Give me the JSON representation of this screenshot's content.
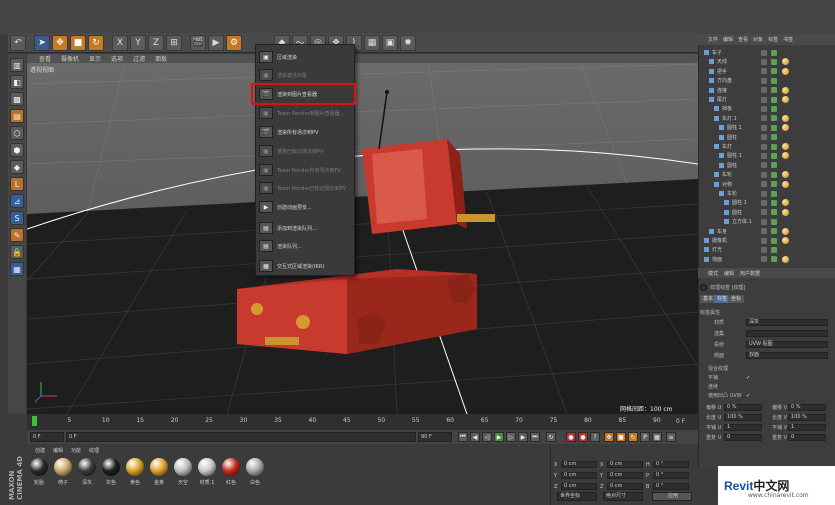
{
  "toolbar": {
    "icons": [
      "undo-icon",
      "select-icon",
      "move-icon",
      "scale-icon",
      "rotate-icon",
      "x-axis",
      "y-axis",
      "z-axis",
      "coord-icon",
      "render-view-icon",
      "render-icon",
      "render-settings-icon"
    ],
    "axis_labels": [
      "X",
      "Y",
      "Z"
    ]
  },
  "viewport": {
    "menu": [
      "查看",
      "摄像机",
      "显示",
      "选项",
      "过滤",
      "面板"
    ],
    "title": "透视视图",
    "grid_info": "网格间距：100 cm"
  },
  "render_menu": {
    "items": [
      {
        "label": "区域渲染",
        "enabled": true
      },
      {
        "label": "渲染激活对象",
        "enabled": false
      },
      {
        "label": "渲染到图片查看器",
        "enabled": true,
        "highlighted": true
      },
      {
        "label": "Team Render到图片查看器...",
        "enabled": false
      },
      {
        "label": "渲染所有场次到PV",
        "enabled": true
      },
      {
        "label": "渲染已标记场次到PV",
        "enabled": false
      },
      {
        "label": "Team Render所有场次到PV",
        "enabled": false
      },
      {
        "label": "Team Render已标记场次到PV",
        "enabled": false
      },
      {
        "label": "创建动画预览...",
        "enabled": true
      },
      {
        "label": "添加到渲染队列...",
        "enabled": true
      },
      {
        "label": "渲染队列...",
        "enabled": true
      },
      {
        "label": "交互式区域渲染(IRR)",
        "enabled": true
      }
    ]
  },
  "object_manager": {
    "menu": [
      "文件",
      "编辑",
      "查看",
      "对象",
      "标签",
      "书签"
    ],
    "rows": [
      {
        "label": "车子",
        "indent": 0
      },
      {
        "label": "天线",
        "indent": 1
      },
      {
        "label": "把手",
        "indent": 1
      },
      {
        "label": "方向盘",
        "indent": 1
      },
      {
        "label": "连接",
        "indent": 1
      },
      {
        "label": "尾灯",
        "indent": 1
      },
      {
        "label": "挡板",
        "indent": 2
      },
      {
        "label": "车灯.1",
        "indent": 2
      },
      {
        "label": "圆柱.1",
        "indent": 3
      },
      {
        "label": "圆柱",
        "indent": 3
      },
      {
        "label": "车灯",
        "indent": 2
      },
      {
        "label": "圆柱.1",
        "indent": 3
      },
      {
        "label": "圆柱",
        "indent": 3
      },
      {
        "label": "车轮",
        "indent": 2
      },
      {
        "label": "对称",
        "indent": 2
      },
      {
        "label": "车轮",
        "indent": 3
      },
      {
        "label": "圆柱.1",
        "indent": 4
      },
      {
        "label": "圆柱",
        "indent": 4
      },
      {
        "label": "立方体.1",
        "indent": 4
      },
      {
        "label": "车身",
        "indent": 1
      },
      {
        "label": "摄像机",
        "indent": 0
      },
      {
        "label": "灯光",
        "indent": 0
      },
      {
        "label": "地面",
        "indent": 0
      }
    ]
  },
  "attributes": {
    "menu": [
      "模式",
      "编辑",
      "用户数据"
    ],
    "header": "纹理标签 [纹理]",
    "tabs": [
      "基本",
      "标签",
      "坐标"
    ],
    "section": "标签属性",
    "fields": [
      {
        "label": "材质",
        "value": "深灰"
      },
      {
        "label": "选集",
        "value": ""
      },
      {
        "label": "投射",
        "value": "UVW 贴图"
      },
      {
        "label": "侧面",
        "value": "双面"
      }
    ],
    "checks": [
      {
        "label": "混合纹理",
        "value": ""
      },
      {
        "label": "平铺",
        "value": "✓"
      },
      {
        "label": "连续",
        "value": ""
      },
      {
        "label": "使用凹凸 UVW",
        "value": "✓"
      }
    ],
    "pairs": [
      {
        "l1": "偏移 U",
        "v1": "0 %",
        "l2": "偏移 V",
        "v2": "0 %"
      },
      {
        "l1": "长度 U",
        "v1": "100 %",
        "l2": "长度 V",
        "v2": "100 %"
      },
      {
        "l1": "平铺 U",
        "v1": "1",
        "l2": "平铺 V",
        "v2": "1"
      },
      {
        "l1": "重复 U",
        "v1": "0",
        "l2": "重复 V",
        "v2": "0"
      }
    ]
  },
  "timeline": {
    "ticks": [
      "0",
      "5",
      "10",
      "15",
      "20",
      "25",
      "30",
      "35",
      "40",
      "45",
      "50",
      "55",
      "60",
      "65",
      "70",
      "75",
      "80",
      "85",
      "90"
    ],
    "end_label": "0 F",
    "current_frame": "0 F",
    "start_frame": "0 F",
    "end_frame": "90 F",
    "end_frame2": "90 F"
  },
  "materials": {
    "menu": [
      "创建",
      "编辑",
      "功能",
      "纹理"
    ],
    "items": [
      {
        "name": "轮胎",
        "color": "#2a2a2a"
      },
      {
        "name": "椅子",
        "color": "#c9a86a"
      },
      {
        "name": "深灰",
        "color": "#3b3b3b"
      },
      {
        "name": "灰色",
        "color": "#1d1d1d"
      },
      {
        "name": "黄色",
        "color": "#d9a42a"
      },
      {
        "name": "金黄",
        "color": "#e0a12c"
      },
      {
        "name": "天空",
        "color": "#bdbdbd"
      },
      {
        "name": "材质.1",
        "color": "#c8c8c8"
      },
      {
        "name": "红色",
        "color": "#c52a1f"
      },
      {
        "name": "白色",
        "color": "#a8a8a8"
      }
    ]
  },
  "coordinates": {
    "rows": [
      {
        "a": "X",
        "av": "0 cm",
        "b": "X",
        "bv": "0 cm",
        "c": "H",
        "cv": "0 °"
      },
      {
        "a": "Y",
        "av": "0 cm",
        "b": "Y",
        "bv": "0 cm",
        "c": "P",
        "cv": "0 °"
      },
      {
        "a": "Z",
        "av": "0 cm",
        "b": "Z",
        "bv": "0 cm",
        "c": "B",
        "cv": "0 °"
      }
    ],
    "mode1": "世界坐标",
    "mode2": "绝对尺寸",
    "apply": "应用"
  },
  "watermark": {
    "brand": "Revit",
    "brand_cn": "中文网",
    "url": "www.chinarevit.com"
  },
  "colors": {
    "accent_red": "#d11111",
    "highlight_blue": "#4b6f9a",
    "car_red": "#c8392e"
  }
}
